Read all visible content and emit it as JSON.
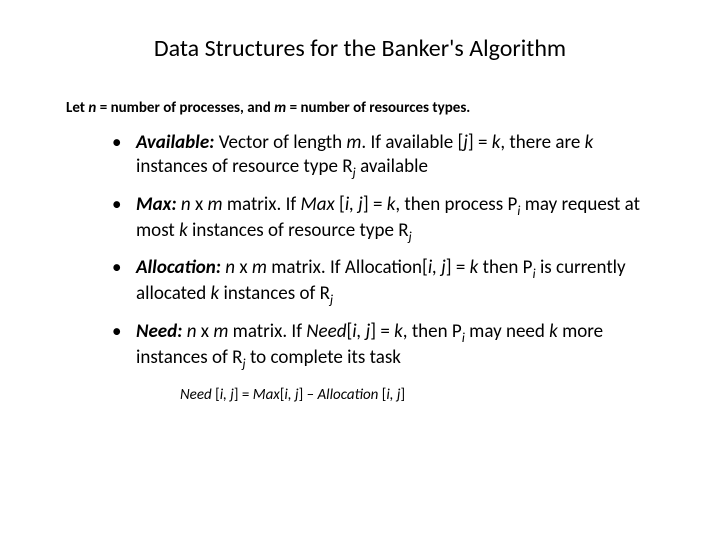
{
  "title": "Data Structures for the Banker's Algorithm",
  "intro": {
    "prefix": "Let ",
    "n": "n",
    "mid": " = number of processes, and ",
    "m": "m",
    "suffix": " = number of resources types."
  },
  "bullets": {
    "available": {
      "term": "Available:",
      "t1": "  Vector of length ",
      "m": "m",
      "t2": ". If available [",
      "j": "j",
      "t3": "] = ",
      "k": "k",
      "t4": ", there are ",
      "k2": "k",
      "t5": " instances of resource type R",
      "jsub": "j",
      "t6": " available"
    },
    "max": {
      "term": "Max:",
      "t1": " ",
      "n": "n",
      "t2": " x ",
      "m": "m",
      "t3": " matrix.  If ",
      "mx": "Max",
      "t4": " [",
      "ij": "i, j",
      "t5": "] = ",
      "k": "k",
      "t6": ", then process P",
      "isub": "i",
      "t7": " may request at most ",
      "k2": "k",
      "t8": " instances of resource type R",
      "jsub": "j"
    },
    "allocation": {
      "term": "Allocation:",
      "t1": "  ",
      "n": "n",
      "t2": " x ",
      "m": "m",
      "t3": " matrix.  If Allocation[",
      "ij": "i, j",
      "t4": "] = ",
      "k": "k",
      "t5": " then P",
      "isub": "i",
      "t6": " is currently allocated ",
      "k2": "k",
      "t7": " instances of R",
      "jsub": "j"
    },
    "need": {
      "term": "Need:",
      "t1": "  ",
      "n": "n",
      "t2": " x ",
      "m": "m",
      "t3": " matrix. If ",
      "nd": "Need",
      "t4": "[",
      "ij": "i, j",
      "t5": "] = ",
      "k": "k",
      "t6": ", then P",
      "isub": "i",
      "t7": " may need ",
      "k2": "k",
      "t8": " more instances of R",
      "jsub": "j",
      "t9": " to complete its task"
    }
  },
  "formula": {
    "lhs": "Need ",
    "lb1": "[",
    "ij1": "i, j",
    "rb1": "]",
    "eq": " = ",
    "max": "Max",
    "lb2": "[",
    "ij2": "i, j",
    "rb2": "]",
    "minus": " – ",
    "alloc": "Allocation ",
    "lb3": "[",
    "ij3": "i, j",
    "rb3": "]"
  }
}
